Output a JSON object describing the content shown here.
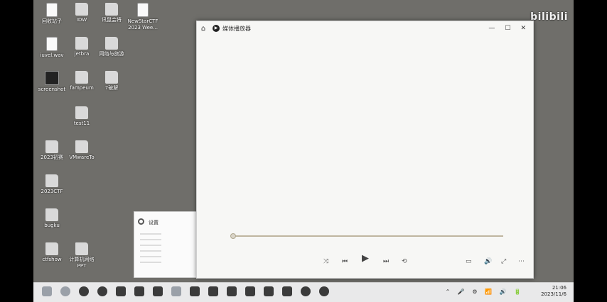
{
  "watermark": "bilibili",
  "desktop_icons": [
    {
      "label": "回收站子",
      "type": "file"
    },
    {
      "label": "IDW",
      "type": "folder"
    },
    {
      "label": "讯鼠会将",
      "type": "folder"
    },
    {
      "label": "NewStarCTF 2023 Wee...",
      "type": "file"
    },
    {
      "label": "iuvel.wav",
      "type": "file"
    },
    {
      "label": "jetbra",
      "type": "folder"
    },
    {
      "label": "网络与旅游",
      "type": "folder"
    },
    {
      "label": "screenshot",
      "type": "dark"
    },
    {
      "label": "fampeum",
      "type": "folder"
    },
    {
      "label": "7破解",
      "type": "folder"
    },
    {
      "label": "test11",
      "type": "folder"
    },
    {
      "label": "2023初赛",
      "type": "folder"
    },
    {
      "label": "VMwareTo",
      "type": "folder"
    },
    {
      "label": "2023CTF",
      "type": "folder"
    },
    {
      "label": "bugku",
      "type": "folder"
    },
    {
      "label": "ctfshow",
      "type": "folder"
    },
    {
      "label": "计算机网络 PPT",
      "type": "folder"
    }
  ],
  "player": {
    "title": "媒体播放器",
    "home_icon": "home-icon",
    "controls": [
      "shuffle",
      "previous",
      "play",
      "next",
      "repeat",
      "captions",
      "volume",
      "more"
    ]
  },
  "settings_window": {
    "title": "设置"
  },
  "taskbar": {
    "time": "21:06",
    "date": "2023/11/6"
  }
}
